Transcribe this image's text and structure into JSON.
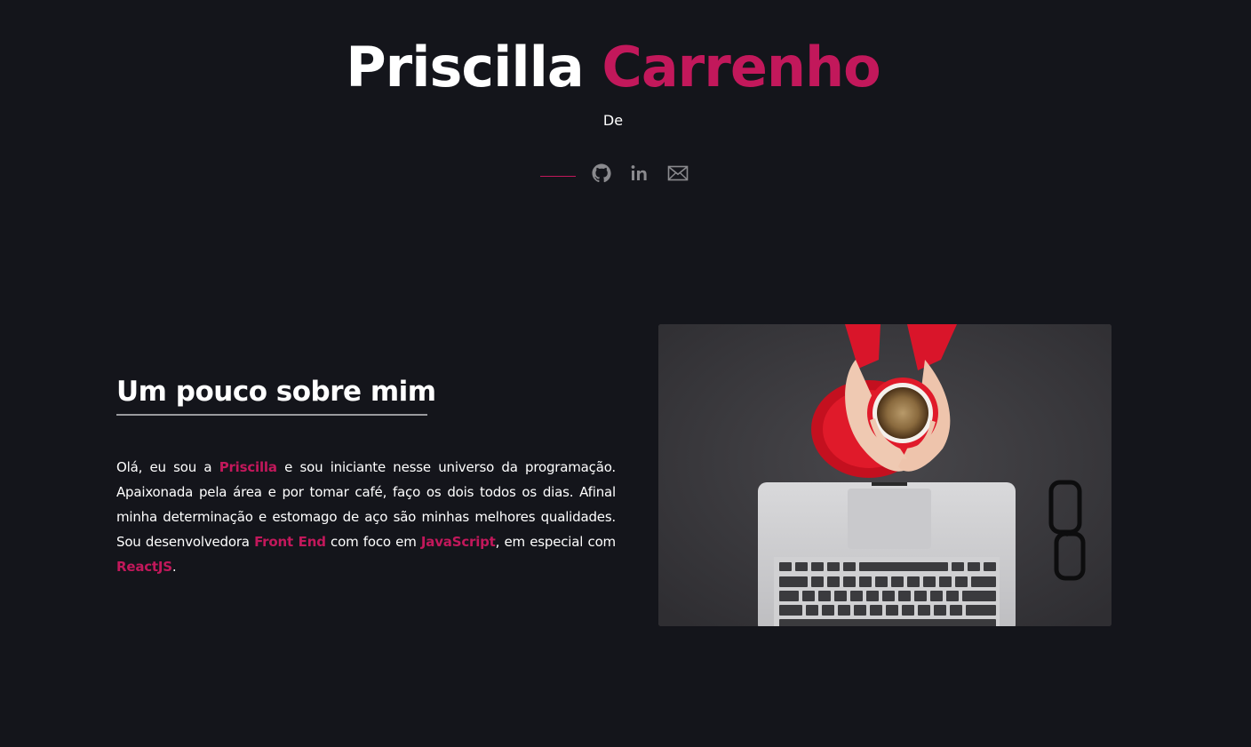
{
  "header": {
    "first_name": "Priscilla",
    "last_name": "Carrenho",
    "subtitle": "De"
  },
  "socials": [
    {
      "name": "github",
      "icon": "github-icon"
    },
    {
      "name": "linkedin",
      "icon": "linkedin-icon"
    },
    {
      "name": "email",
      "icon": "mail-icon"
    }
  ],
  "about": {
    "heading": "Um pouco sobre mim",
    "p1": "Olá, eu sou a ",
    "hl_name": "Priscilla",
    "p2": " e sou iniciante nesse universo da programação. Apaixonada pela área e por tomar café, faço os dois todos os dias. Afinal minha determinação e estomago de aço são minhas melhores qualidades. Sou desenvolvedora ",
    "hl_role": "Front End",
    "p3": " com foco em ",
    "hl_lang": "JavaScript",
    "p4": ", em especial com ",
    "hl_framework": "ReactJS",
    "p5": "."
  },
  "colors": {
    "background": "#14151b",
    "accent": "#c2185b",
    "text": "#ffffff",
    "icon": "#8a8a8e"
  }
}
